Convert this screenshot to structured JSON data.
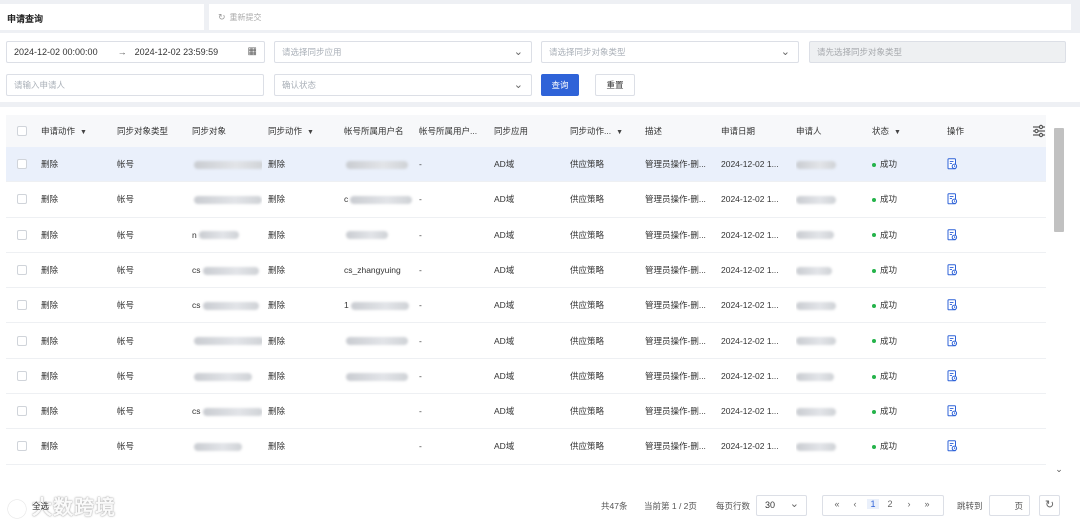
{
  "tabs": {
    "active": "申请查询",
    "refresh_label": "重新提交"
  },
  "filters": {
    "date_start": "2024-12-02 00:00:00",
    "date_arrow": "→",
    "date_end": "2024-12-02 23:59:59",
    "sync_app_placeholder": "请选择同步应用",
    "sync_object_type_placeholder": "请选择同步对象类型",
    "disabled_placeholder": "请先选择同步对象类型",
    "applicant_placeholder": "请输入申请人",
    "confirm_status_placeholder": "确认状态",
    "query_button": "查询",
    "reset_button": "重置"
  },
  "table": {
    "columns": [
      "申请动作",
      "同步对象类型",
      "同步对象",
      "同步动作",
      "帐号所属用户名",
      "帐号所属用户...",
      "同步应用",
      "同步动作...",
      "描述",
      "申请日期",
      "申请人",
      "状态",
      "操作"
    ],
    "rows": [
      {
        "action": "删除",
        "obj_type": "帐号",
        "obj_text": "",
        "sync_action": "删除",
        "username_text": "",
        "user2": "-",
        "app": "AD域",
        "sync_action2": "供应策略",
        "desc": "管理员操作-删...",
        "date": "2024-12-02 1...",
        "status": "成功"
      },
      {
        "action": "删除",
        "obj_type": "帐号",
        "obj_text": "",
        "sync_action": "删除",
        "username_text": "c",
        "user2": "-",
        "app": "AD域",
        "sync_action2": "供应策略",
        "desc": "管理员操作-删...",
        "date": "2024-12-02 1...",
        "status": "成功"
      },
      {
        "action": "删除",
        "obj_type": "帐号",
        "obj_text": "n",
        "sync_action": "删除",
        "username_text": "",
        "user2": "-",
        "app": "AD域",
        "sync_action2": "供应策略",
        "desc": "管理员操作-删...",
        "date": "2024-12-02 1...",
        "status": "成功"
      },
      {
        "action": "删除",
        "obj_type": "帐号",
        "obj_text": "cs",
        "sync_action": "删除",
        "username_text": "cs_zhangyuing",
        "user2": "-",
        "app": "AD域",
        "sync_action2": "供应策略",
        "desc": "管理员操作-删...",
        "date": "2024-12-02 1...",
        "status": "成功"
      },
      {
        "action": "删除",
        "obj_type": "帐号",
        "obj_text": "cs",
        "sync_action": "删除",
        "username_text": "1",
        "user2": "-",
        "app": "AD域",
        "sync_action2": "供应策略",
        "desc": "管理员操作-删...",
        "date": "2024-12-02 1...",
        "status": "成功"
      },
      {
        "action": "删除",
        "obj_type": "帐号",
        "obj_text": "",
        "sync_action": "删除",
        "username_text": "",
        "user2": "-",
        "app": "AD域",
        "sync_action2": "供应策略",
        "desc": "管理员操作-删...",
        "date": "2024-12-02 1...",
        "status": "成功"
      },
      {
        "action": "删除",
        "obj_type": "帐号",
        "obj_text": "",
        "sync_action": "删除",
        "username_text": "",
        "user2": "-",
        "app": "AD域",
        "sync_action2": "供应策略",
        "desc": "管理员操作-删...",
        "date": "2024-12-02 1...",
        "status": "成功"
      },
      {
        "action": "删除",
        "obj_type": "帐号",
        "obj_text": "cs",
        "sync_action": "删除",
        "username_text": "",
        "user2": "-",
        "app": "AD域",
        "sync_action2": "供应策略",
        "desc": "管理员操作-删...",
        "date": "2024-12-02 1...",
        "status": "成功"
      },
      {
        "action": "删除",
        "obj_type": "帐号",
        "obj_text": "",
        "sync_action": "删除",
        "username_text": "",
        "user2": "-",
        "app": "AD域",
        "sync_action2": "供应策略",
        "desc": "管理员操作-删...",
        "date": "2024-12-02 1...",
        "status": "成功"
      }
    ]
  },
  "pagination": {
    "select_all": "全选",
    "total": "共47条",
    "current_page": "当前第 1 / 2页",
    "page_size_label": "每页行数",
    "page_size": "30",
    "pages": [
      "1",
      "2"
    ],
    "first": "«",
    "prev": "‹",
    "next": "›",
    "last": "»",
    "jump_label": "跳转到",
    "page_unit": "页"
  },
  "watermark": "大数跨境",
  "colors": {
    "primary": "#2f63d8",
    "success": "#24b34a",
    "selected_row": "#eaf0fb"
  }
}
